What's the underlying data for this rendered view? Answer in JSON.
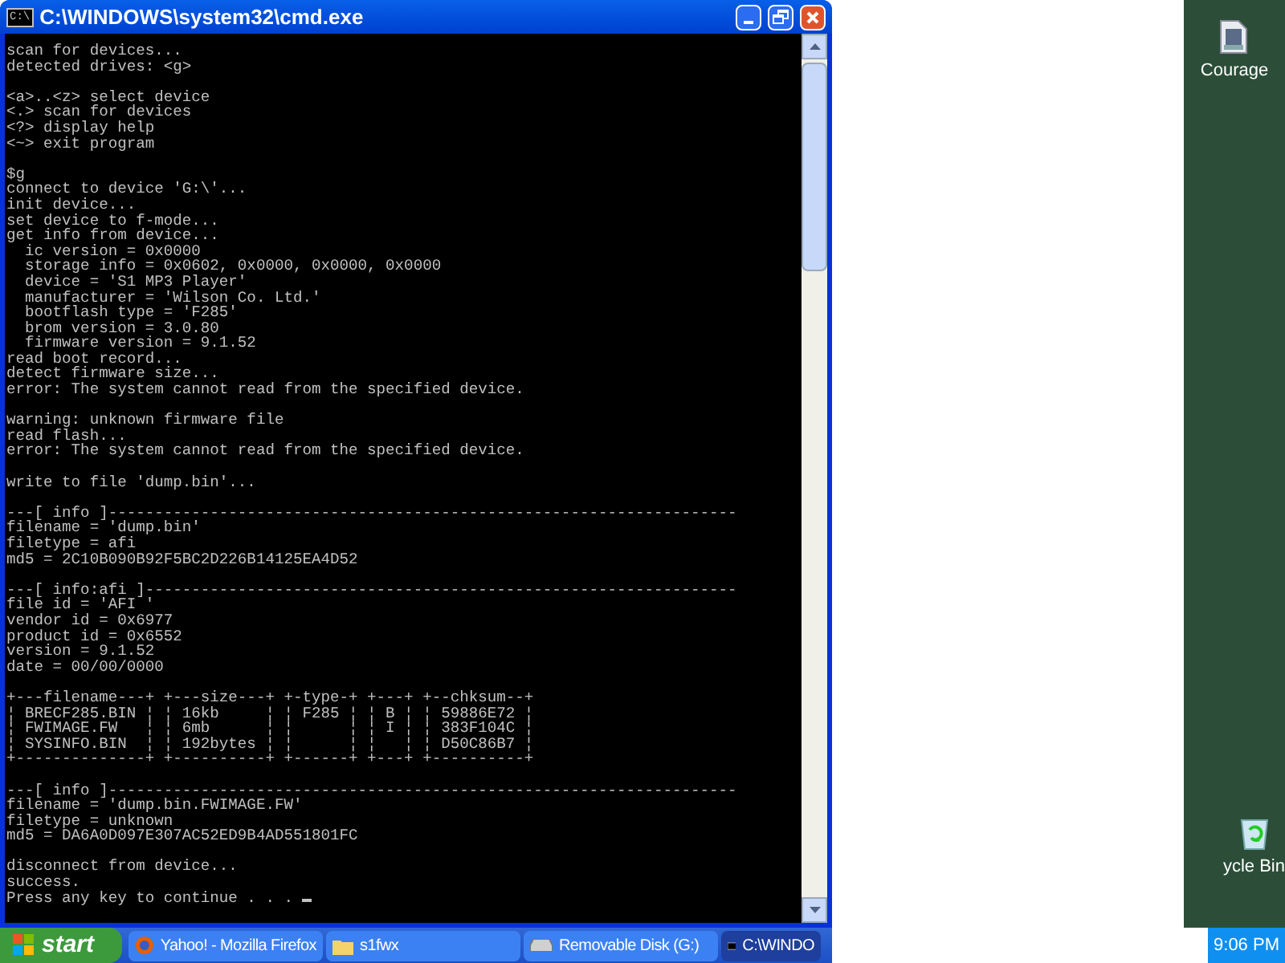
{
  "window": {
    "title": "C:\\WINDOWS\\system32\\cmd.exe",
    "icon_text": "C:\\"
  },
  "console": {
    "blocks": [
      [
        "scan for devices...",
        "detected drives: <g>"
      ],
      [
        "<a>..<z> select device",
        "<.> scan for devices",
        "<?> display help",
        "<~> exit program"
      ],
      [
        "$g",
        "connect to device 'G:\\'...",
        "init device...",
        "set device to f-mode...",
        "get info from device...",
        "  ic version = 0x0000",
        "  storage info = 0x0602, 0x0000, 0x0000, 0x0000",
        "  device = 'S1 MP3 Player'",
        "  manufacturer = 'Wilson Co. Ltd.'",
        "  bootflash type = 'F285'",
        "  brom version = 3.0.80",
        "  firmware version = 9.1.52",
        "read boot record...",
        "detect firmware size...",
        "error: The system cannot read from the specified device."
      ],
      [
        "warning: unknown firmware file",
        "read flash...",
        "error: The system cannot read from the specified device."
      ],
      [
        "write to file 'dump.bin'..."
      ],
      [
        "---[ info ]--------------------------------------------------------------------",
        "filename = 'dump.bin'",
        "filetype = afi",
        "md5 = 2C10B090B92F5BC2D226B14125EA4D52"
      ],
      [
        "---[ info:afi ]----------------------------------------------------------------",
        "file id = 'AFI '",
        "vendor id = 0x6977",
        "product id = 0x6552",
        "version = 9.1.52",
        "date = 00/00/0000"
      ],
      [
        "+---filename---+ +---size---+ +-type-+ +---+ +--chksum--+",
        "¦ BRECF285.BIN ¦ ¦ 16kb     ¦ ¦ F285 ¦ ¦ B ¦ ¦ 59886E72 ¦",
        "¦ FWIMAGE.FW   ¦ ¦ 6mb      ¦ ¦      ¦ ¦ I ¦ ¦ 383F104C ¦",
        "¦ SYSINFO.BIN  ¦ ¦ 192bytes ¦ ¦      ¦ ¦   ¦ ¦ D50C86B7 ¦",
        "+--------------+ +----------+ +------+ +---+ +----------+"
      ],
      [
        "---[ info ]--------------------------------------------------------------------",
        "filename = 'dump.bin.FWIMAGE.FW'",
        "filetype = unknown",
        "md5 = DA6A0D097E307AC52ED9B4AD551801FC"
      ],
      [
        "disconnect from device...",
        "success.",
        "Press any key to continue . . . "
      ]
    ]
  },
  "desktop_icons": [
    {
      "label": "Courage",
      "kind": "video"
    },
    {
      "label": "ycle Bin",
      "kind": "recycle"
    }
  ],
  "taskbar": {
    "start": "start",
    "items": [
      {
        "label": "Yahoo! - Mozilla Firefox",
        "kind": "browser",
        "selected": false
      },
      {
        "label": "s1fwx",
        "kind": "folder",
        "selected": false
      },
      {
        "label": "Removable Disk (G:)",
        "kind": "drive",
        "selected": false
      },
      {
        "label": "C:\\WINDO",
        "kind": "console",
        "selected": true
      }
    ],
    "clock": "9:06 PM"
  }
}
